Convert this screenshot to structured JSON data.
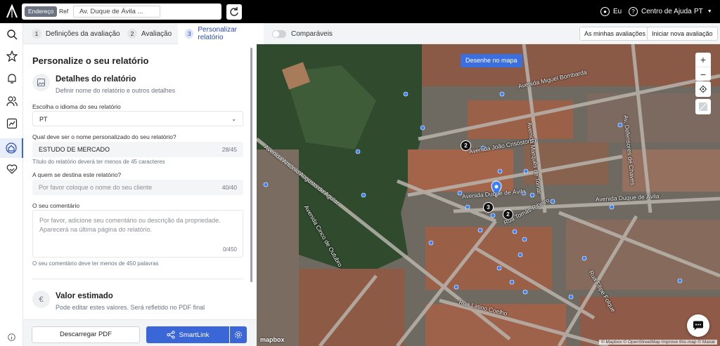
{
  "topbar": {
    "search_mode_active": "Endereço",
    "search_mode_alt": "Ref",
    "address_value": "Av. Duque de Ávila ...",
    "user_label": "Eu",
    "help_label": "Centro de Ajuda",
    "language": "PT"
  },
  "stepper": {
    "steps": [
      {
        "num": "1",
        "label": "Definições da avaliação"
      },
      {
        "num": "2",
        "label": "Avaliação"
      },
      {
        "num": "3",
        "label": "Personalizar relatório"
      }
    ],
    "toggle_label": "Comparáveis",
    "my_reviews": "As minhas avaliações",
    "new_review": "Iniciar nova avaliação"
  },
  "panel": {
    "title": "Personalize o seu relatório",
    "details_title": "Detalhes do relatório",
    "details_sub": "Definir nome do relatório e outros detalhes",
    "lang_label": "Escolha o idioma do seu relatório",
    "lang_value": "PT",
    "name_label": "Qual deve ser o nome personalizado do seu relatório?",
    "name_value": "ESTUDO DE MERCADO",
    "name_counter": "28/45",
    "name_hint": "Título do relatório deverá ter menos de 45 caracteres",
    "recipient_label": "A quem se destina este relatório?",
    "recipient_placeholder": "Por favor coloque o nome do seu cliente",
    "recipient_counter": "40/40",
    "comment_label": "O seu comentário",
    "comment_placeholder": "Por favor, adicione seu comentário ou descrição da propriedade. Aparecerá na última página do relatório.",
    "comment_counter": "0/450",
    "comment_hint": "O seu comentário deve ter menos de 450 palavras",
    "value_title": "Valor estimado",
    "value_sub": "Pode editar estes valores. Será refletido no PDF final"
  },
  "bottom": {
    "pdf_label": "Descarregar PDF",
    "smartlink_label": "SmartLink"
  },
  "map": {
    "draw_label": "Desenhe no mapa",
    "streets": {
      "miguel_bombarda": "Avenida Miguel Bombarda",
      "duque_avila_center": "Avenida Duque de Ávila",
      "duque_avila_right": "Avenida Duque de Ávila",
      "joao_crisostomo": "Avenida João Crisóstomo",
      "cinco_outubro": "Avenida Cinco de Outubro",
      "augusto_aguiar": "Avenida António Augusto de Aguiar",
      "latino_coelho": "Rua Latino Coelho",
      "tomas_ribeiro": "Rua Tomás Ribeiro",
      "rua_filipe": "Rua Filipe Folque",
      "marques_tomar": "Avenida Marquês de Tomar",
      "defensores_chaves": "Av. Defensores de Chaves"
    },
    "cluster_markers": [
      "2",
      "3",
      "2"
    ],
    "mapbox_label": "mapbox",
    "attribution": "© Mapbox © OpenStreetMap  Improve this map  © Maxar"
  },
  "colors": {
    "primary": "#3b66d8",
    "topbar": "#000000",
    "marker": "#3b82f6"
  }
}
